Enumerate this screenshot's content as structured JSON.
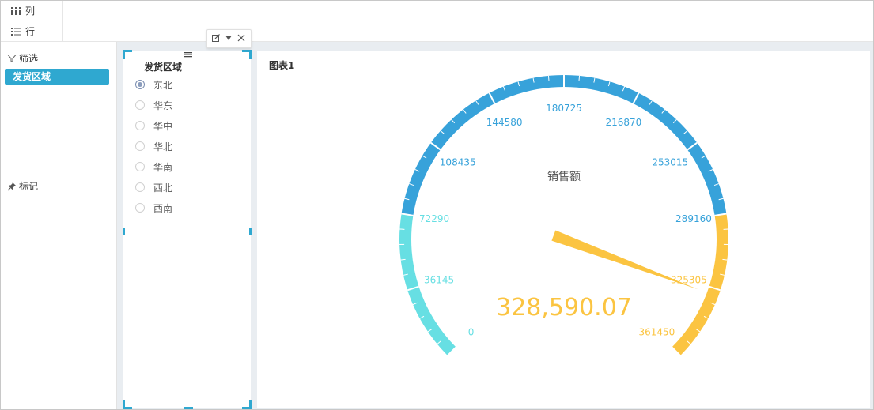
{
  "shelves": {
    "columns_label": "列",
    "rows_label": "行"
  },
  "left_panel": {
    "filter_title": "筛选",
    "filter_field": "发货区域",
    "marks_title": "标记"
  },
  "filter_widget": {
    "title": "发货区域",
    "options": [
      "东北",
      "华东",
      "华中",
      "华北",
      "华南",
      "西北",
      "西南"
    ],
    "selected": "东北"
  },
  "chart": {
    "title": "图表1"
  },
  "chart_data": {
    "type": "gauge",
    "measure_label": "销售额",
    "value": 328590.07,
    "value_display": "328,590.07",
    "min": 0,
    "max": 361450,
    "tick_labels": [
      "0",
      "36145",
      "72290",
      "108435",
      "144580",
      "180725",
      "216870",
      "253015",
      "289160",
      "325305",
      "361450"
    ],
    "bands": [
      {
        "from": 0,
        "to": 72290,
        "color": "#67dfe3"
      },
      {
        "from": 72290,
        "to": 289160,
        "color": "#37a2da"
      },
      {
        "from": 289160,
        "to": 361450,
        "color": "#fbc441"
      }
    ],
    "pointer_color": "#fbc441",
    "value_color": "#fbc441"
  },
  "icons": {
    "columns": "columns-icon",
    "rows": "rows-icon",
    "filter": "funnel-icon",
    "marks": "pin-icon",
    "edit": "edit-icon",
    "dropdown": "caret-down-icon",
    "close": "close-icon",
    "drag": "drag-handle-icon"
  }
}
